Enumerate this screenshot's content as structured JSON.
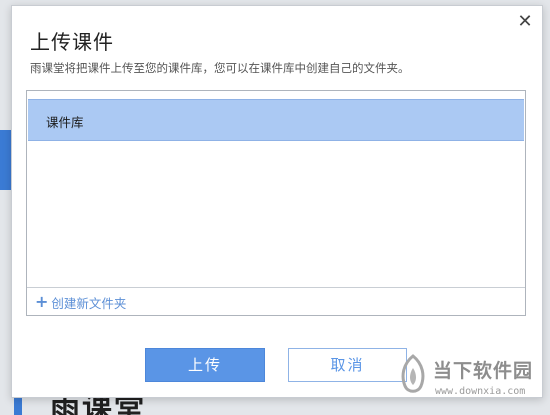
{
  "background": {
    "partial_text": "雨课堂"
  },
  "dialog": {
    "title": "上传课件",
    "subtitle": "雨课堂将把课件上传至您的课件库，您可以在课件库中创建自己的文件夹。",
    "close_icon": "close-icon",
    "library_items": [
      {
        "label": "课件库",
        "selected": true
      }
    ],
    "new_folder_label": "创建新文件夹",
    "upload_label": "上传",
    "cancel_label": "取消"
  },
  "watermark": {
    "title": "当下软件园",
    "url": "www.downxia.com"
  },
  "colors": {
    "accent": "#5a95e6",
    "selected_row": "#abc9f3",
    "link": "#5c8fd6"
  }
}
